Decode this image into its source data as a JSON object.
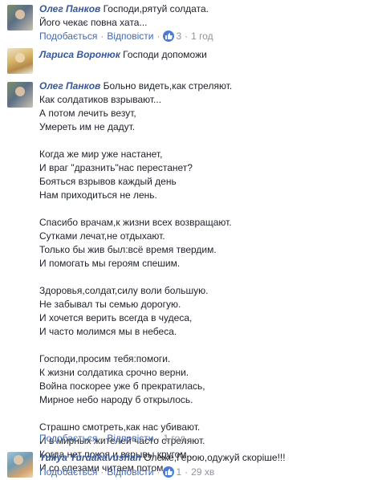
{
  "comments": [
    {
      "author": "Олег Панков",
      "lines": [
        "Господи,рятуй солдата.",
        "Його чекає повна хата..."
      ],
      "like_label": "Подобається",
      "reply_label": "Відповісти",
      "reactions": "3",
      "time": "1 год"
    },
    {
      "author": "Лариса Воронюк",
      "lines": [
        "Господи допоможи"
      ]
    },
    {
      "author": "Олег Панков",
      "lines": [
        "Больно видеть,как стреляют.",
        "Как солдатиков взрывают...",
        "А потом лечить везут,",
        "Умереть им не дадут.",
        "",
        "Когда же мир уже настанет,",
        "И враг \"дразнить\"нас перестанет?",
        "Бояться взрывов каждый день",
        "Нам приходиться не лень.",
        "",
        "Спасибо врачам,к жизни всех возвращают.",
        "Сутками лечат,не отдыхают.",
        "Только бы жив был:всё время твердим.",
        "И помогать мы героям спешим.",
        "",
        "Здоровья,солдат,силу воли большую.",
        "Не забывал ты семью дорогую.",
        "И хочется верить всегда в чудеса,",
        "И часто молимся мы в небеса.",
        "",
        "Господи,просим тебя:помоги.",
        "К жизни солдатика срочно верни.",
        "Война поскорее уже б прекратилась,",
        "Мирное небо народу б открылось.",
        "",
        "Страшно смотреть,как нас убивают.",
        "И в мирных жителей часто стреляют.",
        "Когда нет покоя и взрывы кругом...",
        "И со слезами читаем потом."
      ],
      "like_label": "Подобається",
      "reply_label": "Відповісти",
      "time": "1 год"
    },
    {
      "author": "Yuliya Yurdakavushan",
      "lines": [
        "Олеже,Герою,одужуй скоріше!!!"
      ],
      "like_label": "Подобається",
      "reply_label": "Відповісти",
      "reactions": "1",
      "time": "29 хв"
    }
  ],
  "separator": "·",
  "colors": {
    "name": "#365899",
    "link": "#4267b2",
    "meta": "#90949c",
    "like_reaction": "#4a7bd8"
  },
  "icons": {
    "reaction": "thumbs-up-icon"
  }
}
